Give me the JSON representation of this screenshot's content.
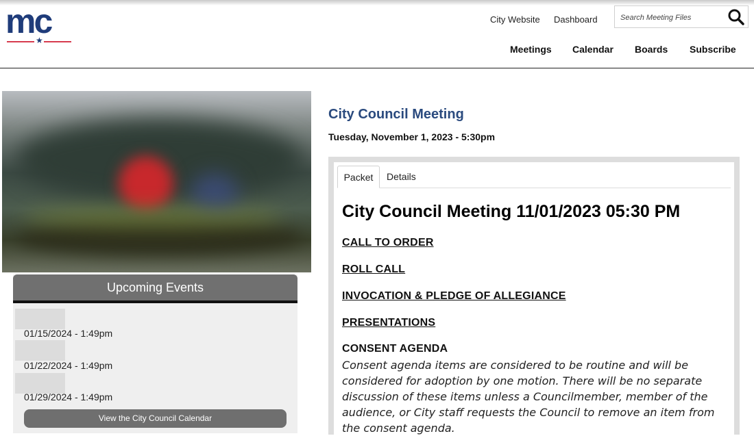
{
  "header": {
    "logo_text": "mc",
    "links": [
      "City Website",
      "Dashboard"
    ],
    "search": {
      "placeholder": "Search Meeting Files"
    },
    "nav": [
      "Meetings",
      "Calendar",
      "Boards",
      "Subscribe"
    ]
  },
  "upcoming": {
    "title": "Upcoming Events",
    "events": [
      "01/15/2024 - 1:49pm",
      "01/22/2024 - 1:49pm",
      "01/29/2024 - 1:49pm"
    ],
    "calendar_button": "View the City Council Calendar"
  },
  "meeting": {
    "title": "City Council Meeting",
    "date": "Tuesday, November 1, 2023 - 5:30pm",
    "tabs": [
      "Packet",
      "Details"
    ],
    "packet": {
      "heading": "City Council Meeting 11/01/2023 05:30 PM",
      "items": [
        "CALL TO ORDER",
        "ROLL CALL",
        "INVOCATION & PLEDGE OF ALLEGIANCE",
        "PRESENTATIONS"
      ],
      "consent_heading": "CONSENT AGENDA",
      "consent_text": "Consent agenda items are considered to be routine and will be considered for adoption by one motion.  There will be no separate discussion of these items unless a Councilmember, member of the audience, or City staff requests the Council to remove an item from the consent agenda."
    }
  },
  "colors": {
    "brand_blue": "#1f3c7a",
    "brand_red": "#d63a4d",
    "title_blue": "#2a4a7e",
    "panel_gray": "#707070"
  }
}
